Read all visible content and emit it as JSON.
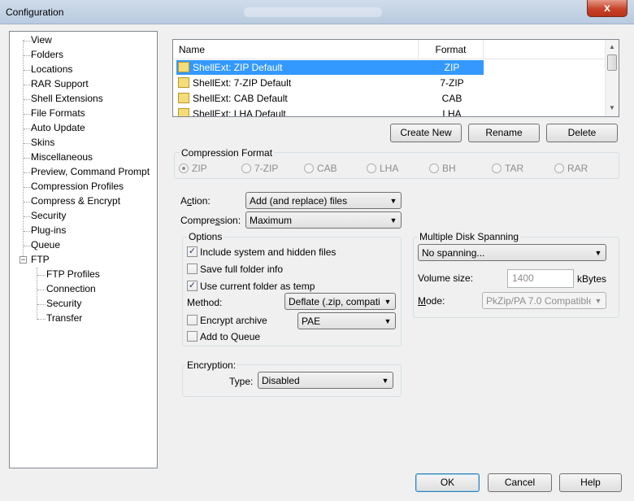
{
  "window": {
    "title": "Configuration",
    "close_glyph": "x"
  },
  "tree": {
    "items": [
      {
        "label": "View"
      },
      {
        "label": "Folders"
      },
      {
        "label": "Locations"
      },
      {
        "label": "RAR Support"
      },
      {
        "label": "Shell Extensions"
      },
      {
        "label": "File Formats"
      },
      {
        "label": "Auto Update"
      },
      {
        "label": "Skins"
      },
      {
        "label": "Miscellaneous"
      },
      {
        "label": "Preview, Command Prompt"
      },
      {
        "label": "Compression Profiles"
      },
      {
        "label": "Compress & Encrypt"
      },
      {
        "label": "Security"
      },
      {
        "label": "Plug-ins"
      },
      {
        "label": "Queue"
      },
      {
        "label": "FTP",
        "expanded": true
      }
    ],
    "ftp_children": [
      {
        "label": "FTP Profiles"
      },
      {
        "label": "Connection"
      },
      {
        "label": "Security"
      },
      {
        "label": "Transfer"
      }
    ],
    "expander_glyph": "−"
  },
  "profiles": {
    "columns": {
      "name": "Name",
      "format": "Format"
    },
    "rows": [
      {
        "name": "ShellExt: ZIP Default",
        "format": "ZIP",
        "selected": true
      },
      {
        "name": "ShellExt: 7-ZIP Default",
        "format": "7-ZIP"
      },
      {
        "name": "ShellExt: CAB Default",
        "format": "CAB"
      },
      {
        "name": "ShellExt: LHA Default",
        "format": "LHA"
      }
    ],
    "scroll_up_glyph": "▲",
    "scroll_down_glyph": "▼"
  },
  "buttons": {
    "create_new": "Create New",
    "rename": "Rename",
    "delete": "Delete",
    "ok": "OK",
    "cancel": "Cancel",
    "help": "Help"
  },
  "compression_format": {
    "label": "Compression Format",
    "options": [
      "ZIP",
      "7-ZIP",
      "CAB",
      "LHA",
      "BH",
      "TAR",
      "RAR"
    ],
    "selected": "ZIP"
  },
  "action": {
    "label_pre": "A",
    "label_ul": "c",
    "label_post": "tion:",
    "value": "Add (and replace) files"
  },
  "compression": {
    "label_pre": "Compre",
    "label_ul": "s",
    "label_post": "sion:",
    "value": "Maximum"
  },
  "options": {
    "label": "Options",
    "include_hidden": {
      "label": "Include system and hidden files",
      "checked": true
    },
    "full_folder": {
      "label": "Save full folder info",
      "checked": false
    },
    "current_folder": {
      "label": "Use current folder as temp",
      "checked": true
    },
    "method_label": "Method:",
    "method_value": "Deflate (.zip, compati",
    "encrypt": {
      "label": "Encrypt archive",
      "checked": false
    },
    "encrypt_method": "PAE",
    "add_queue": {
      "label": "Add to Queue",
      "checked": false
    },
    "check_glyph": "✓"
  },
  "spanning": {
    "label": "Multiple Disk Spanning",
    "value": "No spanning...",
    "volume_label": "Volume size:",
    "volume_value": "1400",
    "volume_unit": "kBytes",
    "mode_label_ul": "M",
    "mode_label_post": "ode:",
    "mode_value": "PkZip/PA 7.0 Compatible"
  },
  "encryption": {
    "label": "Encryption:",
    "type_label": "Type:",
    "type_value": "Disabled"
  },
  "dropdown_glyph": "▼"
}
